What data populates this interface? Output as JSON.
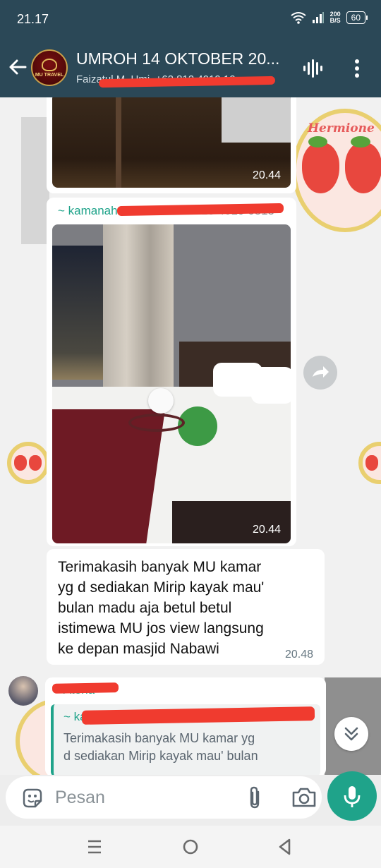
{
  "status_bar": {
    "time": "21.17",
    "net_speed_value": "200",
    "net_speed_unit": "B/S",
    "battery": "60",
    "icons": [
      "wifi-icon",
      "signal-icon",
      "battery-icon"
    ]
  },
  "header": {
    "group_avatar_text": "MU TRAVEL",
    "title": "UMROH 14 OKTOBER 20...",
    "subtitle": "Faizatul M. Umi, +62 812 4019 12..."
  },
  "messages": [
    {
      "type": "image",
      "time": "20.44"
    },
    {
      "type": "image",
      "sender": "~ kamanah12",
      "sender_phone": "+62 813 4019 0815",
      "time": "20.44"
    },
    {
      "type": "text",
      "lines": [
        "Terimakasih banyak MU kamar",
        "yg d sediakan Mirip kayak mau'",
        "bulan madu aja betul betul",
        "istimewa MU jos view langsung",
        "ke depan masjid Nabawi"
      ],
      "time": "20.48"
    },
    {
      "type": "reply",
      "sender": "~ Atena",
      "quote_sender": "~ kamanah12",
      "quote_phone": "+62 813 4019 0815",
      "quote_lines": [
        "Terimakasih banyak MU kamar yg",
        "d sediakan Mirip kayak mau' bulan"
      ]
    }
  ],
  "wallpaper_label": "Hermione",
  "input": {
    "placeholder": "Pesan",
    "value": ""
  },
  "colors": {
    "header": "#2b4857",
    "accent": "#1fa38a",
    "redaction": "#f03b2f"
  }
}
